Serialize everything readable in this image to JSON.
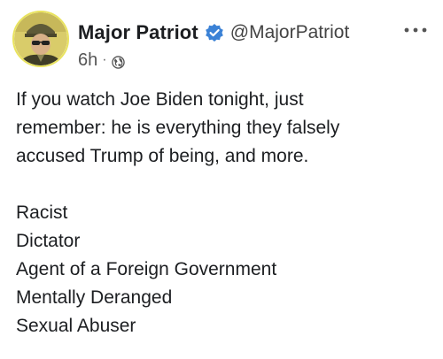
{
  "author": {
    "display_name": "Major Patriot",
    "handle": "@MajorPatriot",
    "verified": true,
    "avatar_icon": "soldier-avatar-icon",
    "verified_color": "#3b82d6"
  },
  "meta": {
    "time_ago": "6h",
    "separator": "·",
    "audience_icon": "globe-icon"
  },
  "menu": {
    "icon": "more-options-icon"
  },
  "post": {
    "intro_lines": [
      "If you watch Joe Biden tonight, just",
      "remember: he is everything they falsely",
      "accused Trump of being, and more."
    ],
    "list_items": [
      "Racist",
      "Dictator",
      "Agent of a Foreign Government",
      "Mentally Deranged",
      "Sexual Abuser"
    ]
  }
}
